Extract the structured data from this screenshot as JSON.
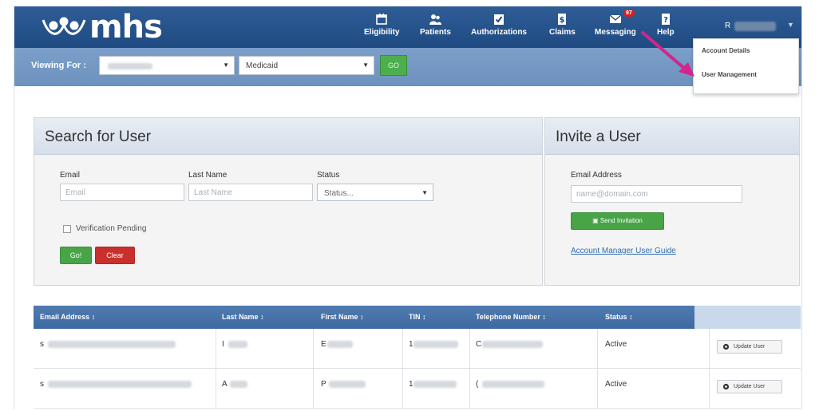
{
  "brand": {
    "logo_text": "mhs"
  },
  "nav": {
    "items": [
      {
        "label": "Eligibility",
        "icon": "calendar-icon"
      },
      {
        "label": "Patients",
        "icon": "users-icon"
      },
      {
        "label": "Authorizations",
        "icon": "checklist-icon"
      },
      {
        "label": "Claims",
        "icon": "dollar-doc-icon"
      },
      {
        "label": "Messaging",
        "icon": "envelope-icon"
      },
      {
        "label": "Help",
        "icon": "question-doc-icon"
      }
    ],
    "messaging_badge": "97",
    "user_initial": "R"
  },
  "account_menu": {
    "items": [
      "Account Details",
      "User Management"
    ]
  },
  "viewing_for": {
    "label": "Viewing For :",
    "plan_select": "Medicaid",
    "go_label": "GO"
  },
  "search_panel": {
    "title": "Search for User",
    "email_label": "Email",
    "email_placeholder": "Email",
    "lastname_label": "Last Name",
    "lastname_placeholder": "Last Name",
    "status_label": "Status",
    "status_select": "Status...",
    "verification_label": "Verification Pending",
    "go_label": "Go!",
    "clear_label": "Clear"
  },
  "invite_panel": {
    "title": "Invite a User",
    "email_label": "Email Address",
    "email_placeholder": "name@domain.com",
    "send_label": "Send Invitation",
    "guide_link": "Account Manager User Guide"
  },
  "table": {
    "headers": [
      "Email Address ↕",
      "Last Name ↕",
      "First Name ↕",
      "TIN ↕",
      "Telephone Number ↕",
      "Status ↕"
    ],
    "rows": [
      {
        "email_initial": "s",
        "last_initial": "I",
        "first_initial": "E",
        "tin_initial": "1",
        "phone_initial": "C",
        "status": "Active",
        "action": "Update User"
      },
      {
        "email_initial": "s",
        "last_initial": "A",
        "first_initial": "P",
        "tin_initial": "1",
        "phone_initial": "(",
        "status": "Active",
        "action": "Update User"
      }
    ]
  },
  "colors": {
    "navbar": "#1f4a82",
    "viewbar": "#6d92be",
    "table_header": "#3e6aa2",
    "success": "#47a447",
    "danger": "#c9302c",
    "link": "#2f6db0",
    "annotation_arrow": "#d6248c"
  }
}
